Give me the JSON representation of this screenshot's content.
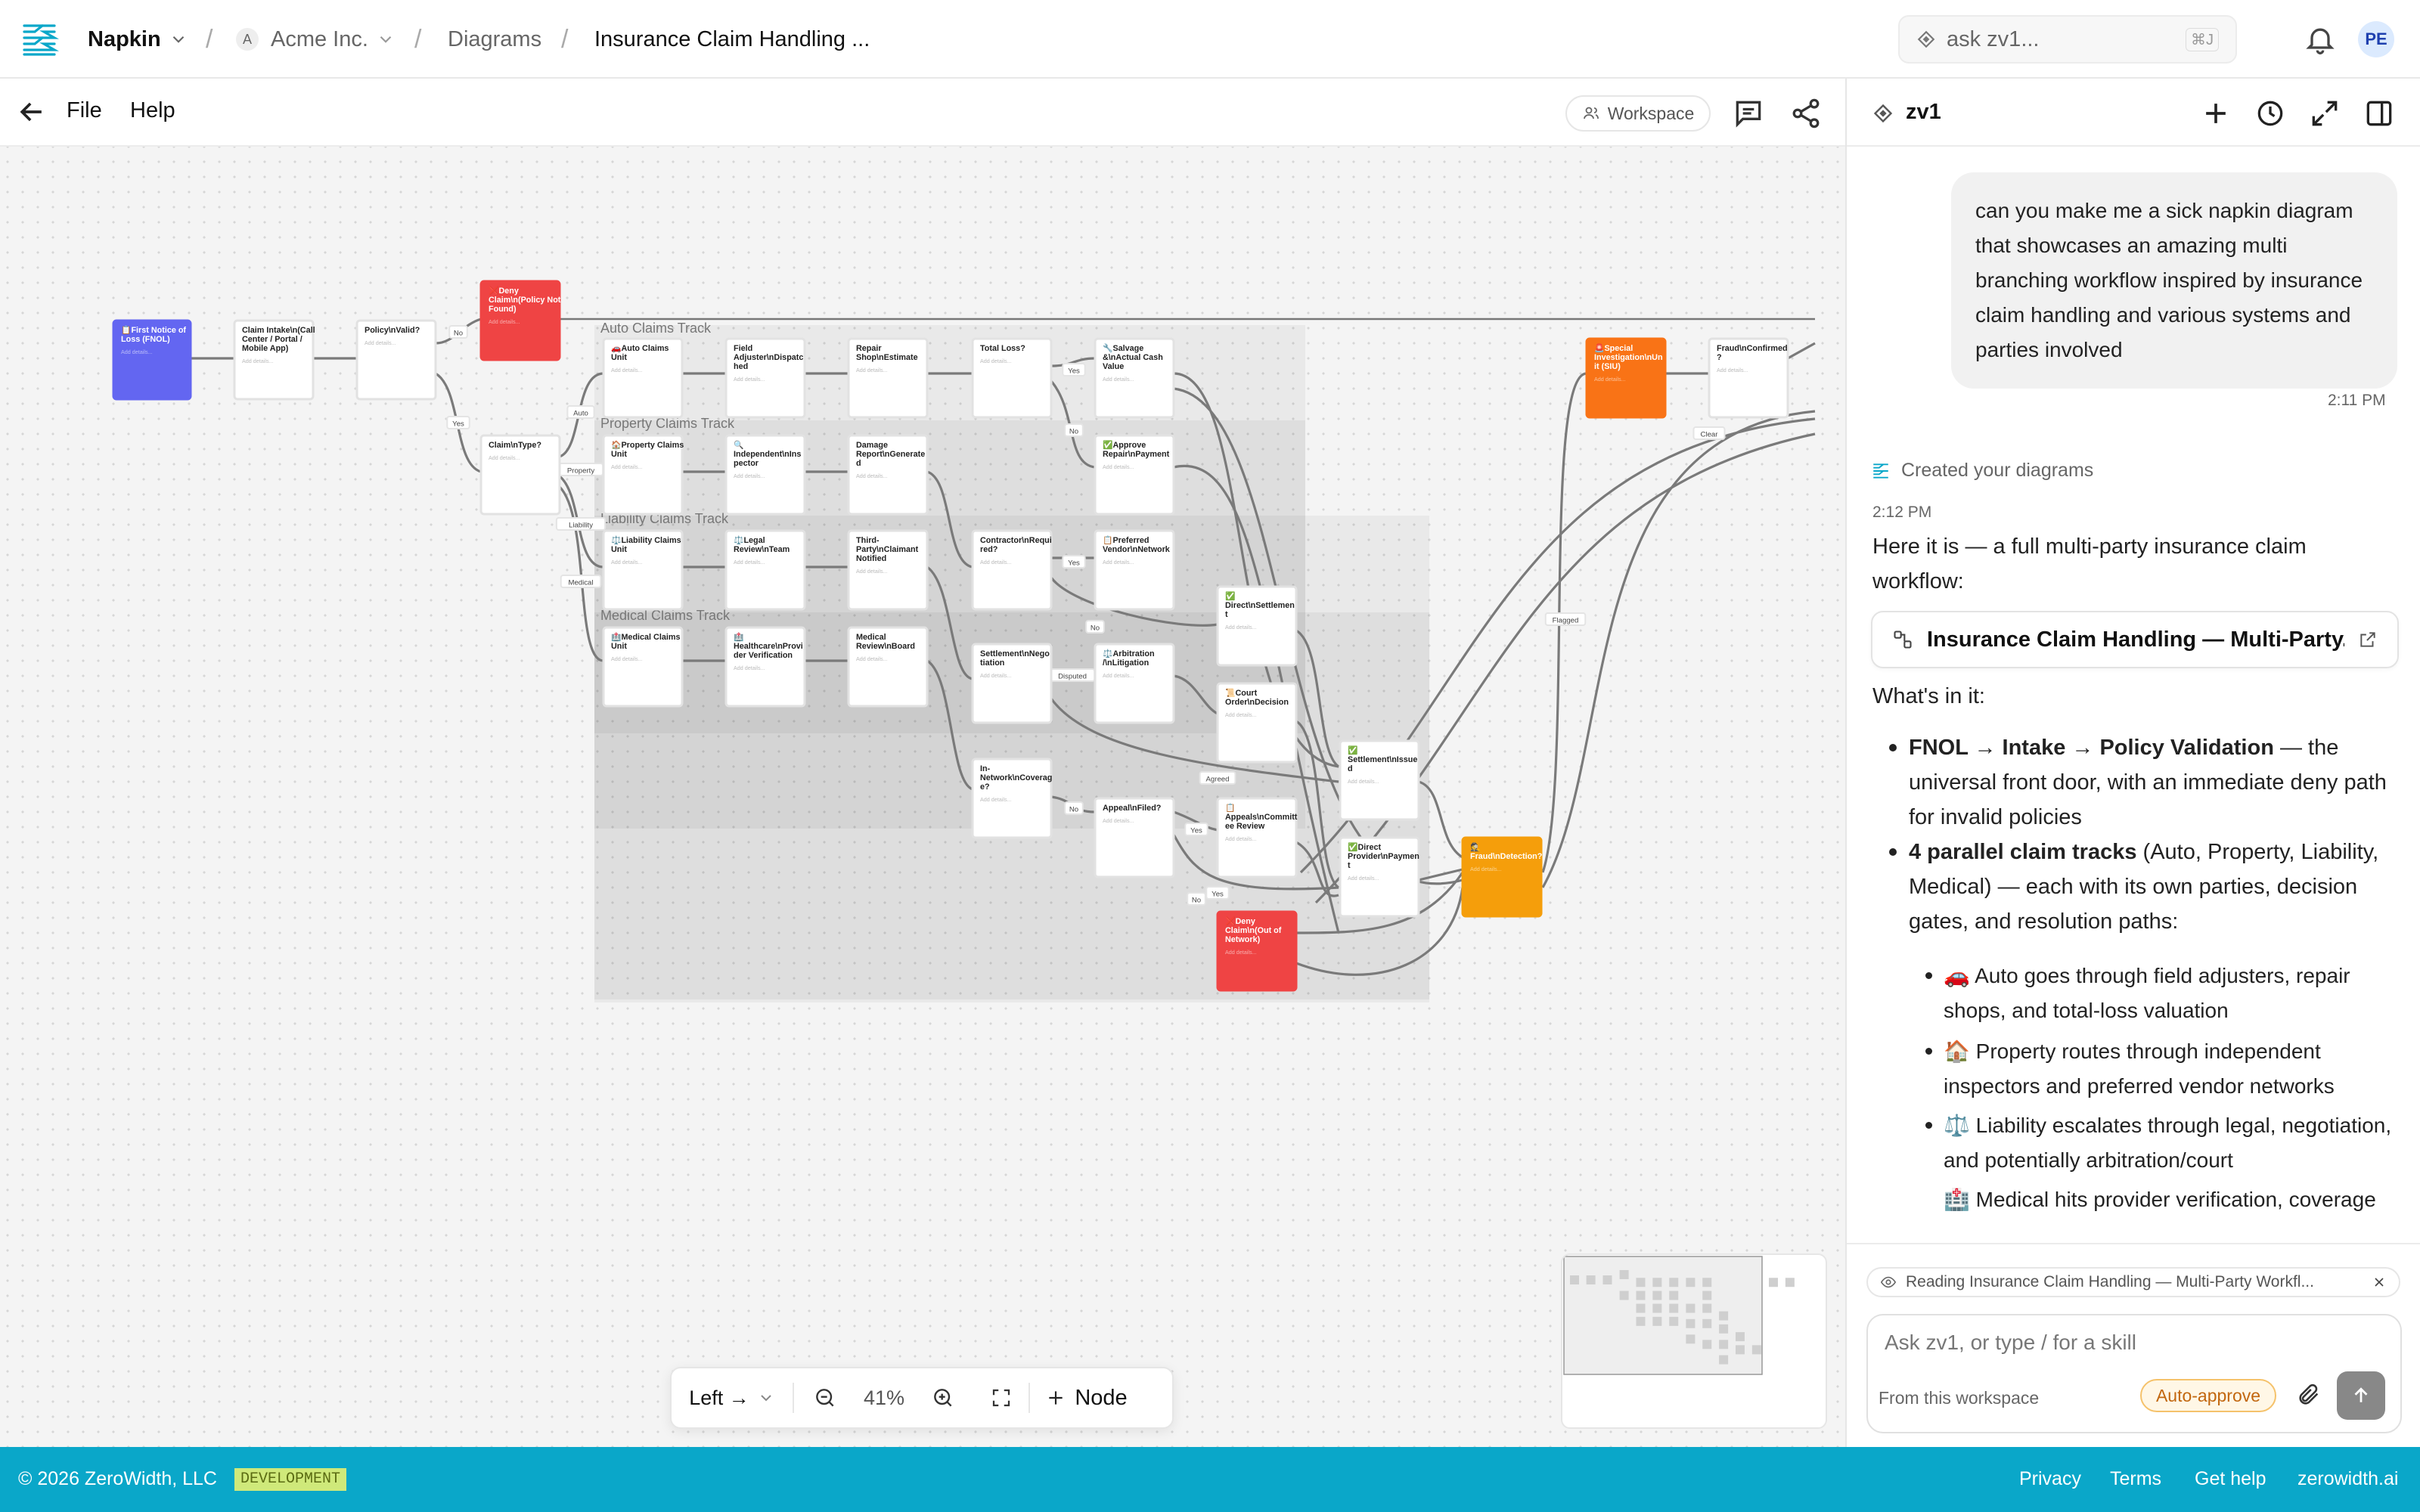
{
  "topbar": {
    "app_name": "Napkin",
    "org_initial": "A",
    "org_name": "Acme Inc.",
    "section": "Diagrams",
    "doc_title": "Insurance Claim Handling ...",
    "search_placeholder": "ask zv1...",
    "search_shortcut": "⌘J",
    "avatar_initials": "PE"
  },
  "canvas_bar": {
    "file_label": "File",
    "help_label": "Help",
    "workspace_label": "Workspace"
  },
  "diagram": {
    "placeholder": "Add details...",
    "groups": {
      "auto": "Auto Claims Track",
      "property": "Property Claims Track",
      "liability": "Liability Claims Track",
      "medical": "Medical Claims Track"
    },
    "nodes": {
      "fnol": [
        "📋First Notice of",
        "Loss (FNOL)"
      ],
      "intake": [
        "Claim Intake\\n(Call",
        "Center / Portal /",
        "Mobile App)"
      ],
      "policy": [
        "Policy\\nValid?"
      ],
      "deny_policy": [
        "❌Deny",
        "Claim\\n(Policy Not",
        "Found)"
      ],
      "claim_type": [
        "Claim\\nType?"
      ],
      "auto_unit": [
        "🚗Auto Claims",
        "Unit"
      ],
      "field_adj": [
        "Field",
        "Adjuster\\nDispatc",
        "hed"
      ],
      "repair_shop": [
        "Repair",
        "Shop\\nEstimate"
      ],
      "total_loss": [
        "Total Loss?"
      ],
      "salvage": [
        "🔧Salvage",
        "&\\nActual Cash",
        "Value"
      ],
      "prop_unit": [
        "🏠Property Claims",
        "Unit"
      ],
      "indep_insp": [
        "🔍",
        "Independent\\nIns",
        "pector"
      ],
      "damage_report": [
        "Damage",
        "Report\\nGenerate",
        "d"
      ],
      "approve_repair": [
        "✅Approve",
        "Repair\\nPayment"
      ],
      "liab_unit": [
        "⚖️Liability Claims",
        "Unit"
      ],
      "legal_review": [
        "⚖️Legal",
        "Review\\nTeam"
      ],
      "third_party": [
        "Third-",
        "Party\\nClaimant",
        "Notified"
      ],
      "contractor": [
        "Contractor\\nRequi",
        "red?"
      ],
      "pref_vendor": [
        "📋Preferred",
        "Vendor\\nNetwork"
      ],
      "direct_settle": [
        "✅",
        "Direct\\nSettlemen",
        "t"
      ],
      "med_unit": [
        "🏥Medical Claims",
        "Unit"
      ],
      "provider_verif": [
        "🏥",
        "Healthcare\\nProvi",
        "der Verification"
      ],
      "med_board": [
        "Medical",
        "Review\\nBoard"
      ],
      "settle_nego": [
        "Settlement\\nNego",
        "tiation"
      ],
      "arbitration": [
        "⚖️Arbitration",
        "/\\nLitigation"
      ],
      "court_order": [
        "📜Court",
        "Order\\nDecision"
      ],
      "in_network": [
        "In-",
        "Network\\nCoverag",
        "e?"
      ],
      "appeal_filed": [
        "Appeal\\nFiled?"
      ],
      "appeals_committee": [
        "📋",
        "Appeals\\nCommitt",
        "ee Review"
      ],
      "settle_issued": [
        "✅",
        "Settlement\\nIssue",
        "d"
      ],
      "direct_provider": [
        "✅Direct",
        "Provider\\nPaymen",
        "t"
      ],
      "deny_network": [
        "❌Deny",
        "Claim\\n(Out of",
        "Network)"
      ],
      "fraud_detect": [
        "🕵",
        "Fraud\\nDetection?"
      ],
      "siu": [
        "🚨Special",
        "Investigation\\nUn",
        "it (SIU)"
      ],
      "fraud_confirmed": [
        "Fraud\\nConfirmed",
        "?"
      ]
    },
    "edge_labels": {
      "no1": "No",
      "yes1": "Yes",
      "auto": "Auto",
      "property": "Property",
      "liability": "Liability",
      "medical": "Medical",
      "yes2": "Yes",
      "no2": "No",
      "yes3": "Yes",
      "no3": "No",
      "disputed": "Disputed",
      "agreed": "Agreed",
      "no4": "No",
      "yes4": "Yes",
      "yes5": "Yes",
      "no5": "No",
      "clear": "Clear",
      "flagged": "Flagged"
    }
  },
  "toolbar": {
    "direction_label": "Left →",
    "zoom": "41%",
    "node_label": "Node"
  },
  "panel": {
    "title": "zv1",
    "user_message": "can you make me a sick napkin diagram that showcases an amazing multi branching workflow inspired by insurance claim handling and various systems and parties involved",
    "user_time": "2:11 PM",
    "created_label": "Created your diagrams",
    "reply_time": "2:12 PM",
    "reply_intro": "Here it is — a full multi-party insurance claim workflow:",
    "artifact_title": "Insurance Claim Handling — Multi-Party...",
    "whats_in_it": "What's in it:",
    "bullet1_bold": "FNOL → Intake → Policy Validation",
    "bullet1_rest": " — the universal front door, with an immediate deny path for invalid policies",
    "bullet2_bold": "4 parallel claim tracks",
    "bullet2_rest": " (Auto, Property, Liability, Medical) — each with its own parties, decision gates, and resolution paths:",
    "sub1": "🚗 Auto goes through field adjusters, repair shops, and total-loss valuation",
    "sub2": "🏠 Property routes through independent inspectors and preferred vendor networks",
    "sub3": "⚖️ Liability escalates through legal, negotiation, and potentially arbitration/court",
    "sub4": "🏥 Medical hits provider verification, coverage checks, and an appeals committee",
    "reading_label": "Reading Insurance Claim Handling — Multi-Party Workfl...",
    "composer_placeholder": "Ask zv1, or type / for a skill",
    "scope_label": "From this workspace",
    "auto_approve_label": "Auto-approve"
  },
  "footer": {
    "copyright": "© 2026 ZeroWidth, LLC",
    "env_badge": "DEVELOPMENT",
    "privacy": "Privacy",
    "terms": "Terms",
    "help": "Get help",
    "site": "zerowidth.ai"
  },
  "colors": {
    "accent": "#0aa7c9",
    "fnol": "#6366f1",
    "deny": "#ef4444",
    "fraud": "#f59e0b",
    "siu": "#f97316"
  }
}
